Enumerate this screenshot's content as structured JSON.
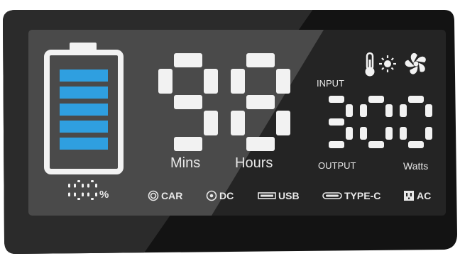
{
  "battery": {
    "percent_value": "100",
    "percent_unit": "%",
    "level": 1.0,
    "bars": 5,
    "bar_color": "#2f9fe0"
  },
  "time": {
    "digits": "98",
    "unit_left": "Mins",
    "unit_right": "Hours"
  },
  "power": {
    "input_label": "INPUT",
    "output_label": "OUTPUT",
    "digits": "300",
    "unit": "Watts"
  },
  "status_icons": [
    "thermometer-icon",
    "sun-icon",
    "fan-icon"
  ],
  "ports": [
    {
      "icon": "car-port-icon",
      "label": "CAR"
    },
    {
      "icon": "dc-port-icon",
      "label": "DC"
    },
    {
      "icon": "usb-port-icon",
      "label": "USB"
    },
    {
      "icon": "type-c-port-icon",
      "label": "TYPE-C"
    },
    {
      "icon": "ac-outlet-icon",
      "label": "AC"
    }
  ],
  "colors": {
    "bezel": "#121212",
    "screen": "#3d3d3d",
    "segment": "#f2f2f2",
    "accent": "#2f9fe0"
  }
}
